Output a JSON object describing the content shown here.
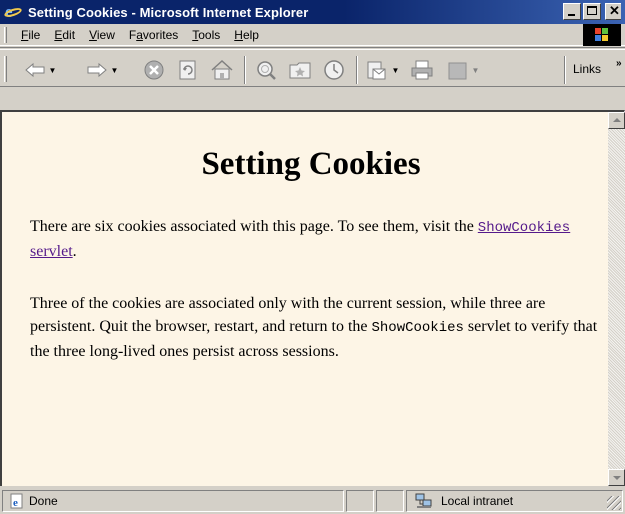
{
  "window": {
    "title": "Setting Cookies - Microsoft Internet Explorer",
    "controls": [
      "minimize",
      "maximize",
      "close"
    ]
  },
  "menu": {
    "items": [
      {
        "label": "File",
        "accel": "F",
        "rest": "ile"
      },
      {
        "label": "Edit",
        "accel": "E",
        "rest": "dit"
      },
      {
        "label": "View",
        "accel": "V",
        "rest": "iew"
      },
      {
        "label": "Favorites",
        "accel": "a",
        "pre": "F",
        "rest": "vorites"
      },
      {
        "label": "Tools",
        "accel": "T",
        "rest": "ools"
      },
      {
        "label": "Help",
        "accel": "H",
        "rest": "elp"
      }
    ]
  },
  "toolbar": {
    "buttons": [
      "back-icon",
      "forward-icon",
      "stop-icon",
      "refresh-icon",
      "home-icon",
      "search-icon",
      "favorites-icon",
      "history-icon",
      "mail-icon",
      "print-icon",
      "edit-icon"
    ],
    "links_label": "Links",
    "links_chevron": "»"
  },
  "page": {
    "heading": "Setting Cookies",
    "p1_text": "There are six cookies associated with this page. To see them, visit the ",
    "p1_link_mono": "ShowCookies",
    "p1_link_rest": " servlet",
    "p1_end": ".",
    "p2_text_a": "Three of the cookies are associated only with the current session, while three are persistent. Quit the browser, restart, and return to the ",
    "p2_mono": "ShowCookies",
    "p2_text_b": " servlet to verify that the three long-lived ones persist across sessions.",
    "background": "#fdf5e6",
    "link_color": "#551a8b"
  },
  "status": {
    "text": "Done",
    "zone": "Local intranet"
  },
  "colors": {
    "titlebar": "#0a246a",
    "chrome": "#d4d0c8"
  }
}
